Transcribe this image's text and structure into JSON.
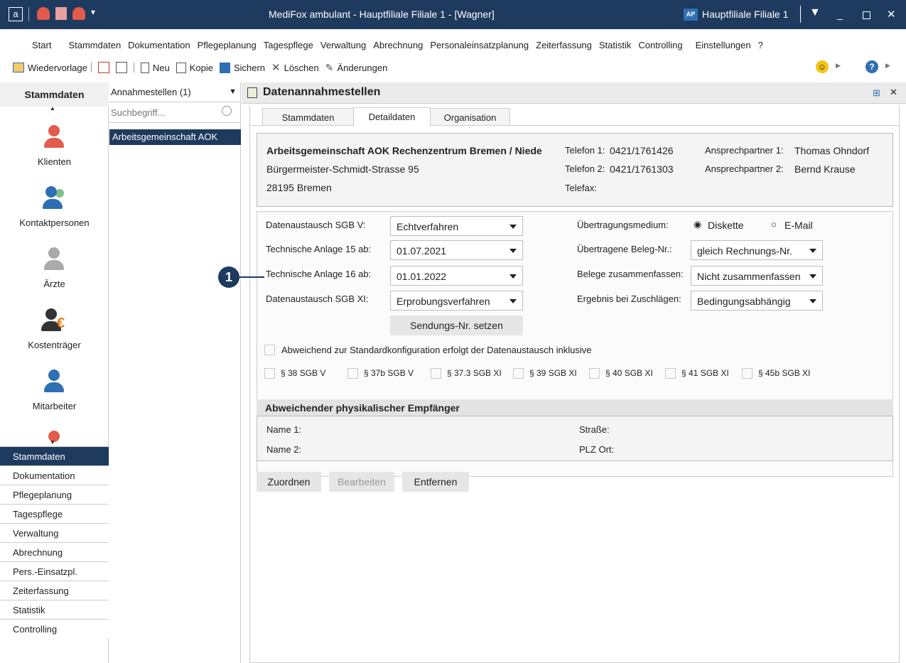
{
  "window": {
    "title": "MediFox ambulant  -  Hauptfiliale Filiale 1 - [Wagner]",
    "branch_badge": "AP",
    "branch_label": "Hauptfiliale Filiale 1",
    "app_icon": "a"
  },
  "menu": [
    "Start",
    "Stammdaten",
    "Dokumentation",
    "Pflegeplanung",
    "Tagespflege",
    "Verwaltung",
    "Abrechnung",
    "Personaleinsatzplanung",
    "Zeiterfassung",
    "Statistik",
    "Controlling",
    "Einstellungen",
    "?"
  ],
  "toolbar": {
    "wiedervorlage": "Wiedervorlage",
    "neu": "Neu",
    "kopie": "Kopie",
    "sichern": "Sichern",
    "loeschen": "Löschen",
    "aenderungen": "Änderungen"
  },
  "left": {
    "header": "Stammdaten",
    "items": [
      "Klienten",
      "Kontaktpersonen",
      "Ärzte",
      "Kostenträger",
      "Mitarbeiter"
    ],
    "bottom": [
      "Stammdaten",
      "Dokumentation",
      "Pflegeplanung",
      "Tagespflege",
      "Verwaltung",
      "Abrechnung",
      "Pers.-Einsatzpl.",
      "Zeiterfassung",
      "Statistik",
      "Controlling"
    ]
  },
  "list": {
    "selector": "Annahmestellen (1)",
    "search_placeholder": "Suchbegriff...",
    "rows": [
      "Arbeitsgemeinschaft AOK"
    ]
  },
  "main": {
    "title": "Datenannahmestellen",
    "tabs": [
      "Stammdaten",
      "Detaildaten",
      "Organisation"
    ],
    "active_tab": "Detaildaten",
    "org_name": "Arbeitsgemeinschaft AOK Rechenzentrum Bremen / Niede",
    "street": "Bürgermeister-Schmidt-Strasse 95",
    "city": "28195  Bremen",
    "tel1_label": "Telefon 1:",
    "tel1": "0421/1761426",
    "tel2_label": "Telefon 2:",
    "tel2": "0421/1761303",
    "fax_label": "Telefax:",
    "ap1_label": "Ansprechpartner 1:",
    "ap1": "Thomas Ohndorf",
    "ap2_label": "Ansprechpartner 2:",
    "ap2": "Bernd Krause",
    "fields": {
      "sgb5_label": "Datenaustausch SGB V:",
      "sgb5": "Echtverfahren",
      "ta15_label": "Technische Anlage 15 ab:",
      "ta15": "01.07.2021",
      "ta16_label": "Technische Anlage 16 ab:",
      "ta16": "01.01.2022",
      "sgb11_label": "Datenaustausch SGB XI:",
      "sgb11": "Erprobungsverfahren",
      "medium_label": "Übertragungsmedium:",
      "medium_opt1": "Diskette",
      "medium_opt2": "E-Mail",
      "beleg_label": "Übertragene Beleg-Nr.:",
      "beleg": "gleich Rechnungs-Nr.",
      "zus_label": "Belege zusammenfassen:",
      "zus": "Nicht zusammenfassen",
      "erg_label": "Ergebnis bei Zuschlägen:",
      "erg": "Bedingungsabhängig",
      "sendung_button": "Sendungs-Nr. setzen",
      "abweichend": "Abweichend zur Standardkonfiguration erfolgt der Datenaustausch inklusive",
      "paragraphs": [
        "§ 38 SGB V",
        "§ 37b SGB V",
        "§ 37.3 SGB XI",
        "§ 39  SGB XI",
        "§ 40 SGB XI",
        "§ 41 SGB XI",
        "§ 45b SGB XI"
      ]
    },
    "recipient": {
      "header": "Abweichender physikalischer Empfänger",
      "name1": "Name 1:",
      "name2": "Name 2:",
      "strasse": "Straße:",
      "plzort": "PLZ  Ort:"
    },
    "buttons": [
      "Zuordnen",
      "Bearbeiten",
      "Entfernen"
    ],
    "marker": "1"
  },
  "colors": {
    "titlebar": "#1e3a5f",
    "accent": "#c0392b",
    "blue": "#2e6fb3"
  }
}
